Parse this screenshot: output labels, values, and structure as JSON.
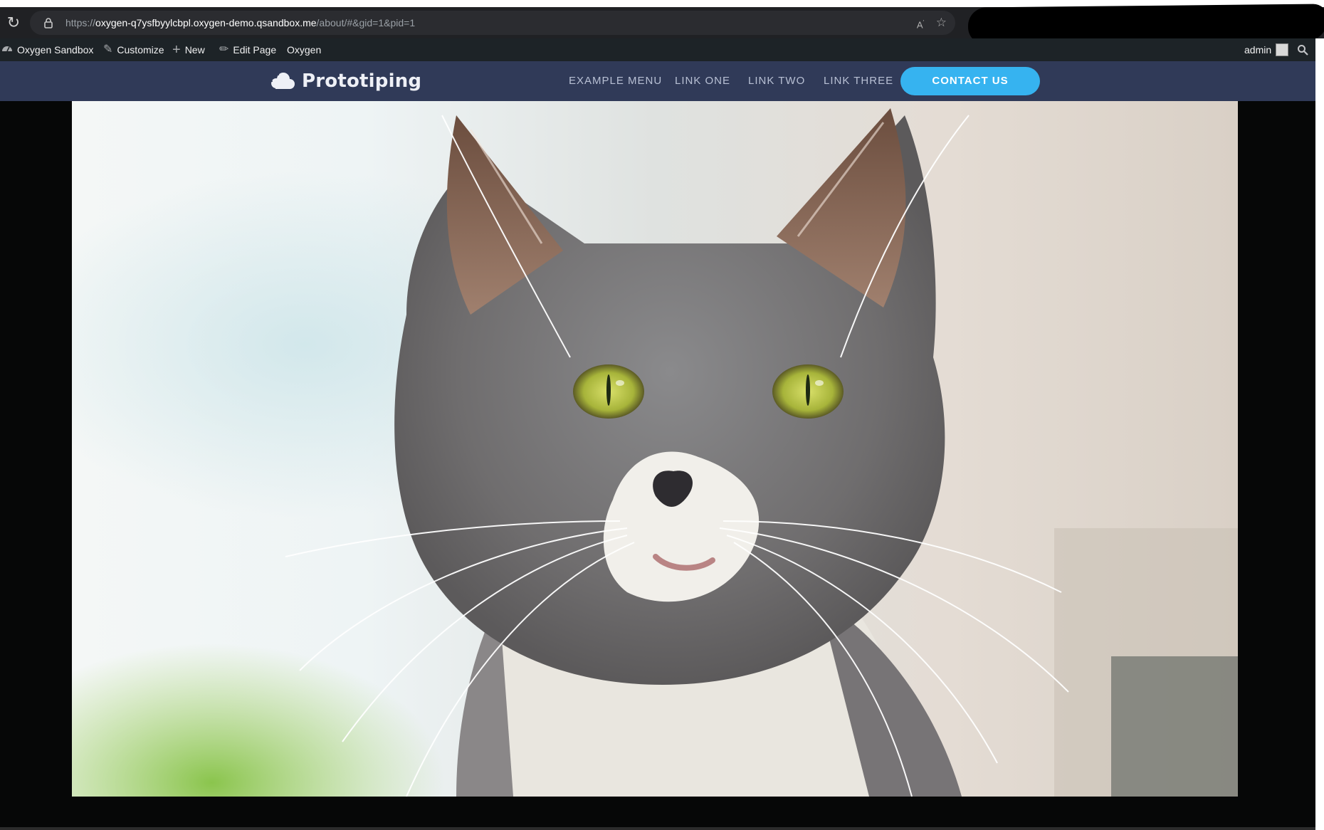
{
  "browser": {
    "url_scheme": "https://",
    "url_host": "oxygen-q7ysfbyylcbpl.oxygen-demo.qsandbox.me",
    "url_path": "/about/#&gid=1&pid=1",
    "read_aloud_label": "A",
    "icons": [
      "reload-icon",
      "lock-icon",
      "read-aloud-icon",
      "favorite-icon"
    ]
  },
  "admin_bar": {
    "site_name": "Oxygen Sandbox",
    "customize": "Customize",
    "new": "New",
    "edit_page": "Edit Page",
    "builder": "Oxygen",
    "user": "admin",
    "icons": [
      "dashboard-icon",
      "brush-icon",
      "plus-icon",
      "pencil-icon",
      "avatar-icon",
      "search-icon"
    ]
  },
  "site_header": {
    "logo_text": "Prototiping",
    "logo_icon": "cloud-icon",
    "nav": [
      "EXAMPLE MENU",
      "LINK ONE",
      "LINK TWO",
      "LINK THREE"
    ],
    "cta": "CONTACT US",
    "colors": {
      "header_bg": "#303a58",
      "cta_bg": "#36b3f0"
    }
  },
  "lightbox": {
    "image_subject": "gray-and-white-cat-photo"
  }
}
